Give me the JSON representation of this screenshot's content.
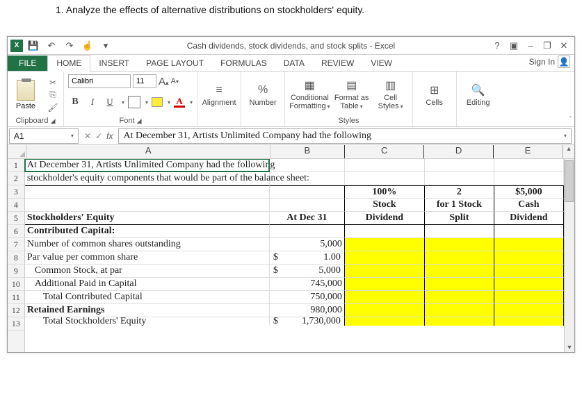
{
  "question": "1. Analyze the effects of alternative distributions on stockholders' equity.",
  "titlebar": {
    "title": "Cash dividends, stock dividends, and stock splits - Excel",
    "help": "?",
    "ribbon_opts": "▣",
    "min": "–",
    "restore": "❐",
    "close": "✕"
  },
  "tabs": {
    "file": "FILE",
    "home": "HOME",
    "insert": "INSERT",
    "page_layout": "PAGE LAYOUT",
    "formulas": "FORMULAS",
    "data": "DATA",
    "review": "REVIEW",
    "view": "VIEW",
    "signin": "Sign In"
  },
  "ribbon": {
    "paste": "Paste",
    "clipboard": "Clipboard",
    "fontname": "Calibri",
    "fontsize": "11",
    "font": "Font",
    "alignment": "Alignment",
    "number": "Number",
    "percent": "%",
    "cond": "Conditional Formatting",
    "fmt_table": "Format as Table",
    "cell_styles": "Cell Styles",
    "styles": "Styles",
    "cells": "Cells",
    "editing": "Editing"
  },
  "fbar": {
    "name": "A1",
    "formula": "At December 31,  Artists Unlimited Company had the following"
  },
  "cols": {
    "A": "A",
    "B": "B",
    "C": "C",
    "D": "D",
    "E": "E"
  },
  "rows": {
    "r1": {
      "A": "At December 31,  Artists Unlimited Company had the following"
    },
    "r2": {
      "A": "stockholder's equity components that would be part of the balance sheet:"
    },
    "r3": {
      "C": "100%",
      "D": "2",
      "E": "$5,000"
    },
    "r4": {
      "C": "Stock",
      "D": "for 1 Stock",
      "E": "Cash"
    },
    "r5": {
      "A": "Stockholders' Equity",
      "B": "At Dec 31",
      "C": "Dividend",
      "D": "Split",
      "E": "Dividend"
    },
    "r6": {
      "A": "Contributed Capital:"
    },
    "r7": {
      "A": "Number of common shares outstanding",
      "B": "5,000"
    },
    "r8": {
      "A": "Par value per common share",
      "Bsym": "$",
      "B": "1.00"
    },
    "r9": {
      "A": "Common Stock, at par",
      "Bsym": "$",
      "B": "5,000"
    },
    "r10": {
      "A": "Additional Paid in Capital",
      "B": "745,000"
    },
    "r11": {
      "A": "Total Contributed Capital",
      "B": "750,000"
    },
    "r12": {
      "A": "Retained Earnings",
      "B": "980,000"
    },
    "r13": {
      "A": "Total Stockholders' Equity",
      "Bsym": "$",
      "B": "1,730,000"
    }
  }
}
